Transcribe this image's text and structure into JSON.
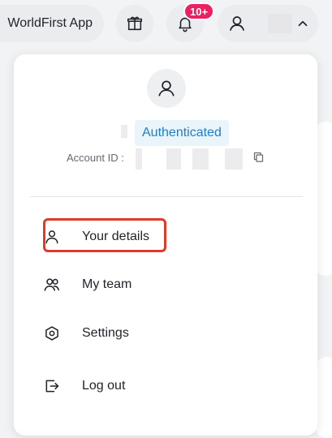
{
  "topbar": {
    "app_label": "WorldFirst App",
    "notification_count": "10+",
    "icons": [
      "gift-icon",
      "bell-icon",
      "user-icon",
      "chevron-up-icon"
    ]
  },
  "profile": {
    "status": "Authenticated",
    "account_id_label": "Account ID :",
    "icons": [
      "user-icon",
      "copy-icon"
    ]
  },
  "menu": {
    "items": [
      {
        "label": "Your details",
        "icon": "user-icon"
      },
      {
        "label": "My team",
        "icon": "team-icon"
      },
      {
        "label": "Settings",
        "icon": "settings-icon"
      },
      {
        "label": "Log out",
        "icon": "logout-icon"
      }
    ]
  },
  "colors": {
    "badge": "#ee1f5f",
    "auth_chip_bg": "#eaf4fb",
    "auth_chip_text": "#1f7ec8",
    "highlight": "#e03a2a"
  }
}
